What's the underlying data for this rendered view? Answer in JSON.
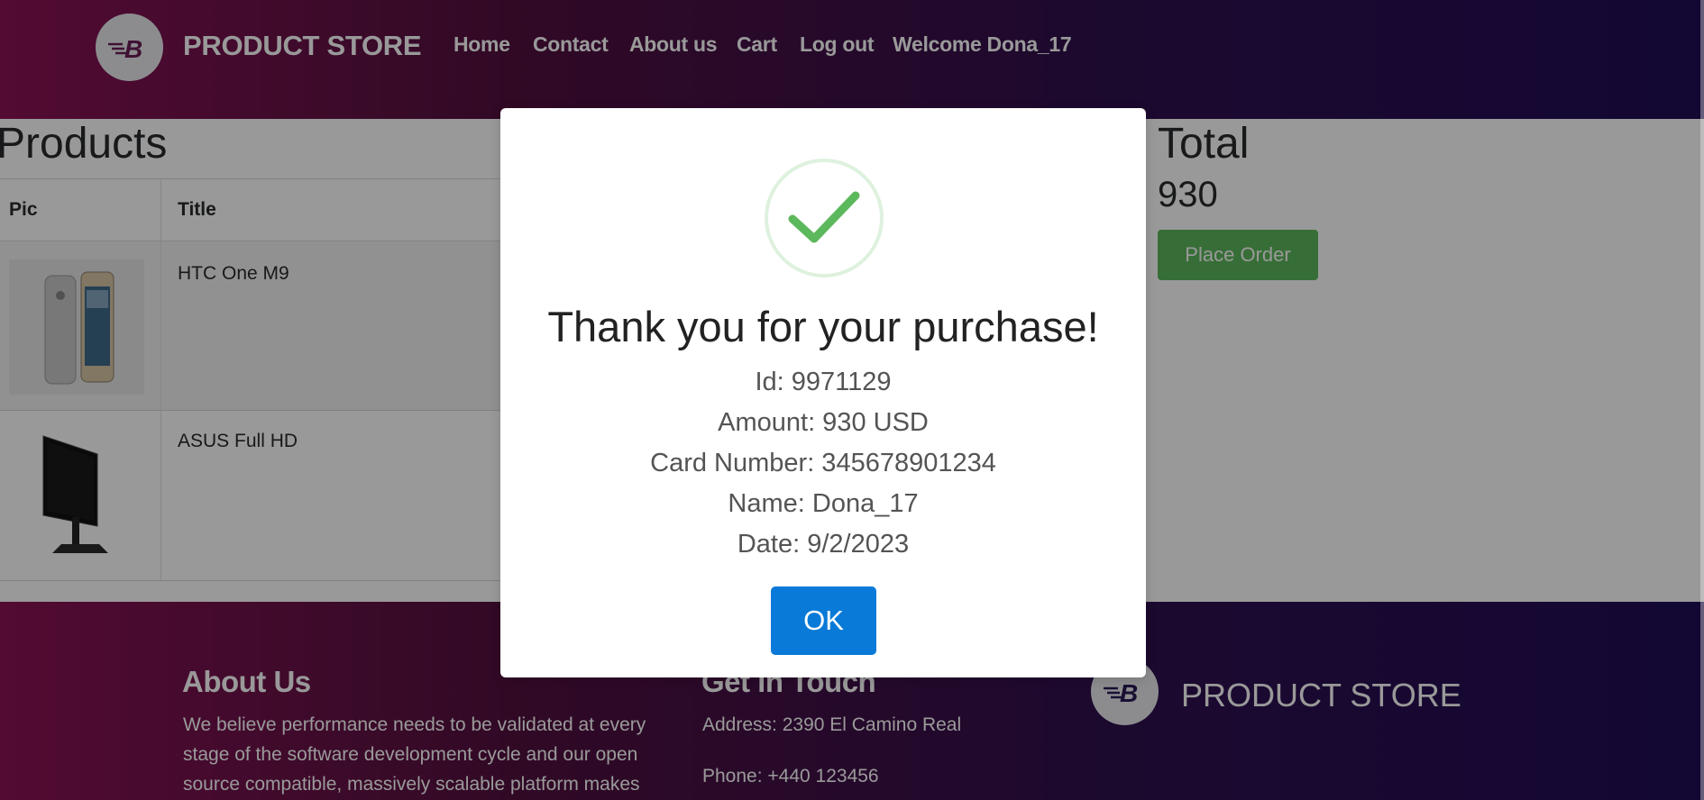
{
  "navbar": {
    "brand": "PRODUCT STORE",
    "links": [
      "Home",
      "Contact",
      "About us",
      "Cart",
      "Log out",
      "Welcome Dona_17"
    ]
  },
  "cart": {
    "products_heading": "Products",
    "columns": [
      "Pic",
      "Title"
    ],
    "rows": [
      {
        "title": "HTC One M9"
      },
      {
        "title": "ASUS Full HD"
      }
    ],
    "total_heading": "Total",
    "total_value": "930",
    "place_order_label": "Place Order"
  },
  "footer": {
    "about_title": "About Us",
    "about_lines": [
      "We believe performance needs to be validated at every",
      "stage of the software development cycle and our open",
      "source compatible, massively scalable platform makes"
    ],
    "contact_title": "Get in Touch",
    "address": "Address: 2390 El Camino Real",
    "phone": "Phone: +440 123456",
    "brand": "PRODUCT STORE"
  },
  "modal": {
    "title": "Thank you for your purchase!",
    "id_line": "Id: 9971129",
    "amount_line": "Amount: 930 USD",
    "card_line": "Card Number: 345678901234",
    "name_line": "Name: Dona_17",
    "date_line": "Date: 9/2/2023",
    "ok_label": "OK"
  },
  "colors": {
    "nav_gradient_start": "#8a1355",
    "nav_gradient_end": "#200d57",
    "place_order": "#5cb85c",
    "ok_button": "#0a7ad8",
    "success": "#5cb85c"
  },
  "icons": [
    "brand-logo-icon",
    "success-check-icon"
  ]
}
